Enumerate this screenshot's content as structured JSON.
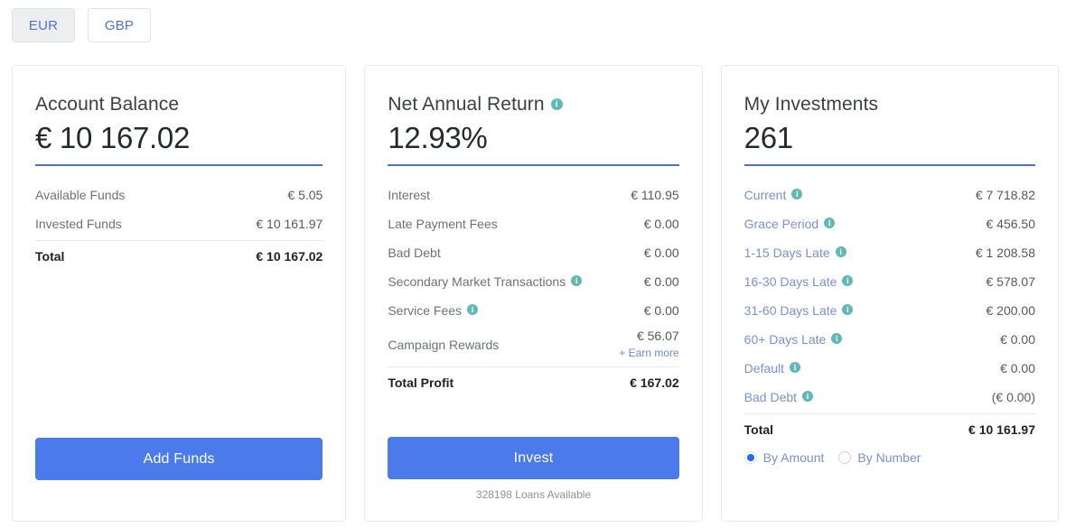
{
  "currency_tabs": {
    "items": [
      {
        "label": "EUR",
        "active": true
      },
      {
        "label": "GBP",
        "active": false
      }
    ]
  },
  "cards": {
    "account_balance": {
      "title": "Account Balance",
      "value": "€ 10 167.02",
      "rows": [
        {
          "label": "Available Funds",
          "value": "€ 5.05"
        },
        {
          "label": "Invested Funds",
          "value": "€ 10 161.97"
        }
      ],
      "total_label": "Total",
      "total_value": "€ 10 167.02",
      "button_label": "Add Funds"
    },
    "net_annual_return": {
      "title": "Net Annual Return",
      "title_info_icon": "info-icon",
      "value": "12.93%",
      "rows": [
        {
          "label": "Interest",
          "value": "€ 110.95",
          "info": false
        },
        {
          "label": "Late Payment Fees",
          "value": "€ 0.00",
          "info": false
        },
        {
          "label": "Bad Debt",
          "value": "€ 0.00",
          "info": false
        },
        {
          "label": "Secondary Market Transactions",
          "value": "€ 0.00",
          "info": true
        },
        {
          "label": "Service Fees",
          "value": "€ 0.00",
          "info": true
        }
      ],
      "campaign": {
        "label": "Campaign Rewards",
        "value": "€ 56.07",
        "link_label": "+ Earn more"
      },
      "total_label": "Total Profit",
      "total_value": "€ 167.02",
      "button_label": "Invest",
      "loans_note": "328198 Loans Available"
    },
    "my_investments": {
      "title": "My Investments",
      "value": "261",
      "rows": [
        {
          "label": "Current",
          "value": "€ 7 718.82",
          "info": true
        },
        {
          "label": "Grace Period",
          "value": "€ 456.50",
          "info": true
        },
        {
          "label": "1-15 Days Late",
          "value": "€ 1 208.58",
          "info": true
        },
        {
          "label": "16-30 Days Late",
          "value": "€ 578.07",
          "info": true
        },
        {
          "label": "31-60 Days Late",
          "value": "€ 200.00",
          "info": true
        },
        {
          "label": "60+ Days Late",
          "value": "€ 0.00",
          "info": true
        },
        {
          "label": "Default",
          "value": "€ 0.00",
          "info": true
        },
        {
          "label": "Bad Debt",
          "value": "(€ 0.00)",
          "info": true
        }
      ],
      "total_label": "Total",
      "total_value": "€ 10 161.97",
      "radios": [
        {
          "label": "By Amount",
          "checked": true
        },
        {
          "label": "By Number",
          "checked": false
        }
      ]
    }
  },
  "colors": {
    "accent_blue": "#4b7bea",
    "rule_blue": "#4a73bd",
    "info_teal": "#63b8b4",
    "link_blue": "#7b90cf"
  }
}
